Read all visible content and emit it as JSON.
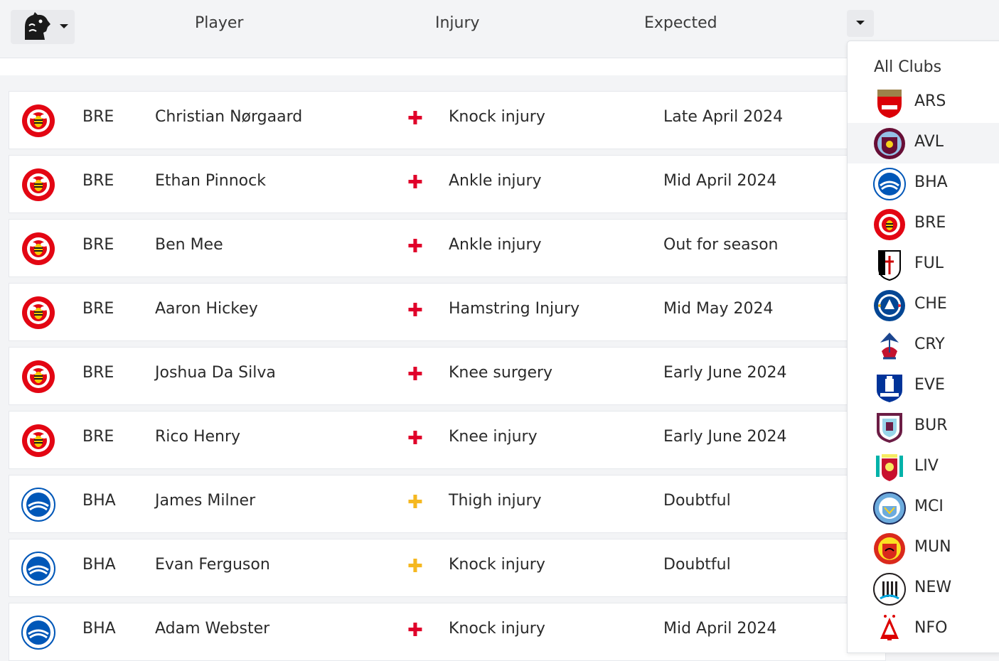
{
  "header": {
    "league_logo": "premier-league-lion-icon",
    "columns": {
      "player": "Player",
      "injury": "Injury",
      "expected": "Expected"
    }
  },
  "colors": {
    "status_red": "#e0002a",
    "status_amber": "#f5b820",
    "brentford_red": "#e30613",
    "brighton_blue": "#0057b8",
    "highlight_bg": "#f3f4f6"
  },
  "rows": [
    {
      "club": "BRE",
      "player": "Christian Nørgaard",
      "status": "out",
      "status_glyph": "✚",
      "injury": "Knock injury",
      "expected": "Late April 2024"
    },
    {
      "club": "BRE",
      "player": "Ethan Pinnock",
      "status": "out",
      "status_glyph": "✚",
      "injury": "Ankle injury",
      "expected": "Mid April 2024"
    },
    {
      "club": "BRE",
      "player": "Ben Mee",
      "status": "out",
      "status_glyph": "✚",
      "injury": "Ankle injury",
      "expected": "Out for season"
    },
    {
      "club": "BRE",
      "player": "Aaron Hickey",
      "status": "out",
      "status_glyph": "✚",
      "injury": "Hamstring Injury",
      "expected": "Mid May 2024"
    },
    {
      "club": "BRE",
      "player": "Joshua Da Silva",
      "status": "out",
      "status_glyph": "✚",
      "injury": "Knee surgery",
      "expected": "Early June 2024"
    },
    {
      "club": "BRE",
      "player": "Rico Henry",
      "status": "out",
      "status_glyph": "✚",
      "injury": "Knee injury",
      "expected": "Early June 2024"
    },
    {
      "club": "BHA",
      "player": "James Milner",
      "status": "doubtful",
      "status_glyph": "✚",
      "injury": "Thigh injury",
      "expected": "Doubtful"
    },
    {
      "club": "BHA",
      "player": "Evan Ferguson",
      "status": "doubtful",
      "status_glyph": "✚",
      "injury": "Knock injury",
      "expected": "Doubtful"
    },
    {
      "club": "BHA",
      "player": "Adam Webster",
      "status": "out",
      "status_glyph": "✚",
      "injury": "Knock injury",
      "expected": "Mid April 2024"
    }
  ],
  "dropdown": {
    "all_label": "All Clubs",
    "highlighted": "AVL",
    "clubs": [
      {
        "abbr": "ARS",
        "icon": "arsenal-crest-icon"
      },
      {
        "abbr": "AVL",
        "icon": "aston-villa-crest-icon"
      },
      {
        "abbr": "BHA",
        "icon": "brighton-crest-icon"
      },
      {
        "abbr": "BRE",
        "icon": "brentford-crest-icon"
      },
      {
        "abbr": "FUL",
        "icon": "fulham-crest-icon"
      },
      {
        "abbr": "CHE",
        "icon": "chelsea-crest-icon"
      },
      {
        "abbr": "CRY",
        "icon": "crystal-palace-crest-icon"
      },
      {
        "abbr": "EVE",
        "icon": "everton-crest-icon"
      },
      {
        "abbr": "BUR",
        "icon": "burnley-crest-icon"
      },
      {
        "abbr": "LIV",
        "icon": "liverpool-crest-icon"
      },
      {
        "abbr": "MCI",
        "icon": "man-city-crest-icon"
      },
      {
        "abbr": "MUN",
        "icon": "man-united-crest-icon"
      },
      {
        "abbr": "NEW",
        "icon": "newcastle-crest-icon"
      },
      {
        "abbr": "NFO",
        "icon": "nottingham-forest-crest-icon"
      }
    ]
  }
}
